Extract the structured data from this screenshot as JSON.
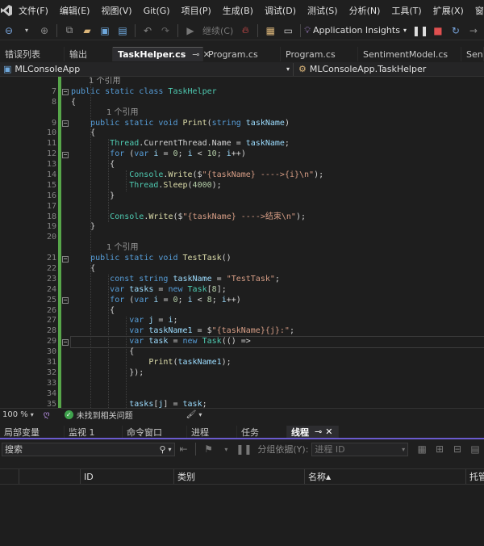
{
  "menu": [
    "文件(F)",
    "编辑(E)",
    "视图(V)",
    "Git(G)",
    "项目(P)",
    "生成(B)",
    "调试(D)",
    "测试(S)",
    "分析(N)",
    "工具(T)",
    "扩展(X)",
    "窗口(W)"
  ],
  "toolbar": {
    "continue_label": "继续(C)",
    "app_insights_label": "Application Insights"
  },
  "tabs": [
    {
      "label": "错误列表"
    },
    {
      "label": "输出"
    },
    {
      "label": "TaskHelper.cs",
      "active": true
    },
    {
      "label": "Program.cs"
    },
    {
      "label": "Program.cs"
    },
    {
      "label": "SentimentModel.cs"
    },
    {
      "label": "Sent"
    }
  ],
  "navbar": {
    "project": "MLConsoleApp",
    "class_path": "MLConsoleApp.TaskHelper"
  },
  "editor": {
    "line_numbers": [
      "",
      "7",
      "8",
      "",
      "9",
      "10",
      "11",
      "12",
      "13",
      "14",
      "15",
      "16",
      "17",
      "18",
      "19",
      "20",
      "",
      "21",
      "22",
      "23",
      "24",
      "25",
      "26",
      "27",
      "28",
      "29",
      "30",
      "31",
      "32",
      "33",
      "34",
      "35"
    ],
    "codelens_ref": "1 个引用",
    "strings": {
      "print_fmt": "\"{taskName} ---->{i}\\n\"",
      "print_end": "\"{taskName} ---->结束\\n\"",
      "testtask": "\"TestTask\"",
      "taskname1": "\"{taskName}{j}:\""
    }
  },
  "edstatus": {
    "zoom": "100 %",
    "status": "未找到相关问题"
  },
  "panel_tabs": [
    {
      "label": "局部变量"
    },
    {
      "label": "监视 1"
    },
    {
      "label": "命令窗口"
    },
    {
      "label": "进程"
    },
    {
      "label": "任务"
    },
    {
      "label": "线程",
      "active": true
    }
  ],
  "threads": {
    "search_placeholder": "搜索",
    "group_by_label": "分组依据(Y):",
    "group_by_value": "进程 ID",
    "columns": [
      "ID",
      "类别",
      "名称",
      "托管"
    ]
  }
}
